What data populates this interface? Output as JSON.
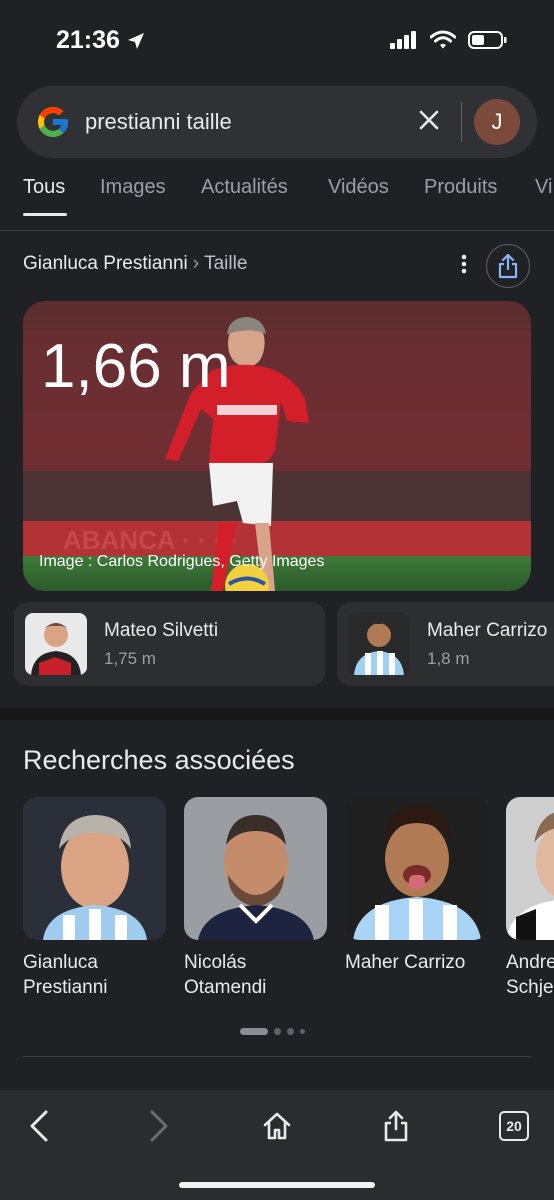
{
  "status_bar": {
    "time": "21:36"
  },
  "search": {
    "query": "prestianni taille",
    "avatar_letter": "J"
  },
  "tabs": [
    {
      "label": "Tous",
      "active": true
    },
    {
      "label": "Images"
    },
    {
      "label": "Actualités"
    },
    {
      "label": "Vidéos"
    },
    {
      "label": "Produits"
    },
    {
      "label": "Vi"
    }
  ],
  "breadcrumb": {
    "entity": "Gianluca Prestianni",
    "separator": "›",
    "attribute": "Taille"
  },
  "answer": {
    "value": "1,66 m",
    "image_credit": "Image : Carlos Rodrigues, Getty Images"
  },
  "related_heights": [
    {
      "name": "Mateo Silvetti",
      "value": "1,75 m"
    },
    {
      "name": "Maher Carrizo",
      "value": "1,8 m"
    }
  ],
  "related_searches": {
    "title": "Recherches associées",
    "items": [
      {
        "line1": "Gianluca",
        "line2": "Prestianni"
      },
      {
        "line1": "Nicolás",
        "line2": "Otamendi"
      },
      {
        "line1": "Maher Carrizo",
        "line2": ""
      },
      {
        "line1": "Andre",
        "line2": "Schje"
      }
    ],
    "page_indicator": {
      "pages": 4,
      "current": 1
    }
  },
  "bottom_bar": {
    "tab_count": "20"
  },
  "colors": {
    "background": "#202124",
    "surface": "#303134",
    "benfica_red": "#d0202a"
  }
}
